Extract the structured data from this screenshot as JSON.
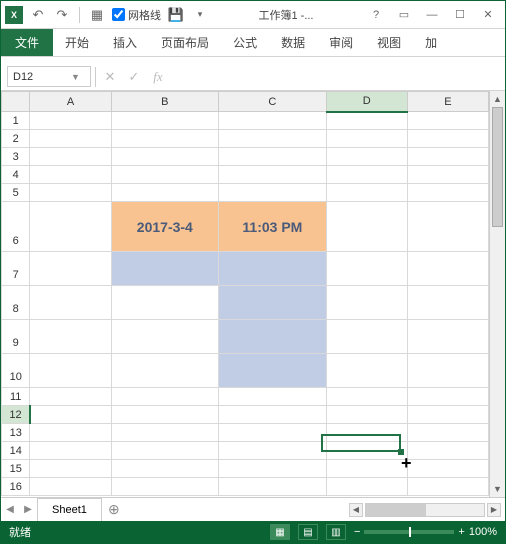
{
  "titlebar": {
    "gridlines_label": "网格线",
    "gridlines_checked": true,
    "title": "工作簿1 -..."
  },
  "ribbon": {
    "file": "文件",
    "tabs": [
      "开始",
      "插入",
      "页面布局",
      "公式",
      "数据",
      "审阅",
      "视图",
      "加"
    ]
  },
  "formula_bar": {
    "name_box": "D12",
    "fx": "fx",
    "value": ""
  },
  "grid": {
    "columns": [
      "A",
      "B",
      "C",
      "D",
      "E"
    ],
    "rows": [
      "1",
      "2",
      "3",
      "4",
      "5",
      "6",
      "7",
      "8",
      "9",
      "10",
      "11",
      "12",
      "13",
      "14",
      "15",
      "16"
    ],
    "active_cell": "D12",
    "active_col_index": 3,
    "active_row_index": 11,
    "cells": {
      "B6": "2017-3-4",
      "C6": "11:03 PM"
    }
  },
  "sheet_tabs": {
    "tabs": [
      "Sheet1"
    ],
    "add": "+"
  },
  "status": {
    "ready": "就绪",
    "zoom": "100%"
  }
}
